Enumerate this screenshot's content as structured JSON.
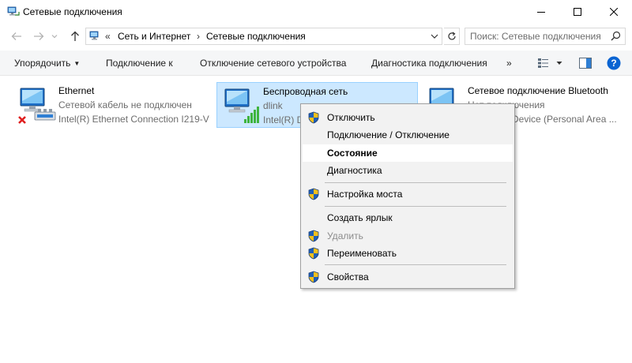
{
  "window": {
    "title": "Сетевые подключения",
    "app_icon": "network-connections-icon",
    "controls": [
      "minimize",
      "maximize",
      "close"
    ]
  },
  "nav": {
    "back_icon": "arrow-left-icon",
    "forward_icon": "arrow-right-icon",
    "up_icon": "arrow-up-icon",
    "overflow": "«",
    "breadcrumbs": [
      "Сеть и Интернет",
      "Сетевые подключения"
    ],
    "search_placeholder": "Поиск: Сетевые подключения"
  },
  "toolbar": {
    "organize": "Упорядочить",
    "connect_to": "Подключение к",
    "disable_device": "Отключение сетевого устройства",
    "diagnose": "Диагностика подключения",
    "more": "»"
  },
  "connections": [
    {
      "name": "Ethernet",
      "status": "Сетевой кабель не подключен",
      "device": "Intel(R) Ethernet Connection I219-V",
      "state": "disconnected"
    },
    {
      "name": "Беспроводная сеть",
      "status": "dlink",
      "device": "Intel(R) D",
      "state": "selected"
    },
    {
      "name": "Сетевое подключение Bluetooth",
      "status": "Нет подключения",
      "device": "Device (Personal Area ...",
      "state": "disconnected"
    }
  ],
  "context_menu": {
    "items": [
      {
        "label": "Отключить",
        "shield": true
      },
      {
        "label": "Подключение / Отключение",
        "shield": false
      },
      {
        "label": "Состояние",
        "shield": false,
        "bold": true,
        "hover": true
      },
      {
        "label": "Диагностика",
        "shield": false
      },
      {
        "label": "Настройка моста",
        "shield": true
      },
      {
        "label": "Создать ярлык",
        "shield": false
      },
      {
        "label": "Удалить",
        "shield": true,
        "disabled": true
      },
      {
        "label": "Переименовать",
        "shield": true
      },
      {
        "label": "Свойства",
        "shield": true
      }
    ]
  },
  "colors": {
    "selection_bg": "#cce8ff",
    "selection_border": "#99d1ff",
    "help_blue": "#0a64d2",
    "signal_green": "#3fb43f",
    "disconnect_red": "#e02020"
  }
}
